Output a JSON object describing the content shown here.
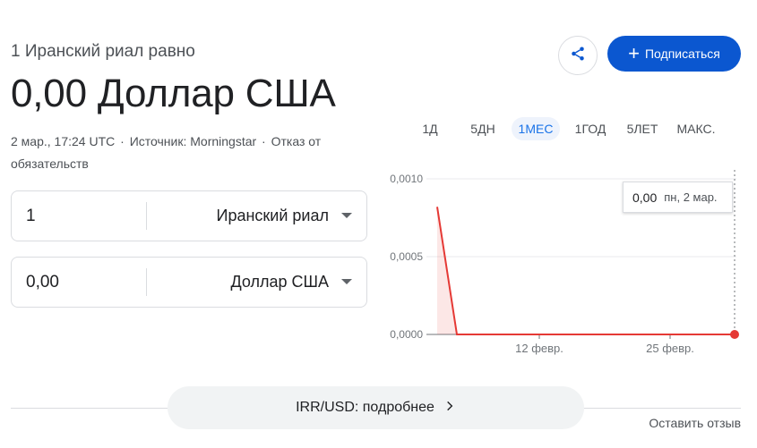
{
  "header": {
    "subtitle": "1 Иранский риал равно",
    "value": "0,00 Доллар США",
    "timestamp": "2 мар., 17:24 UTC",
    "source": "Источник: Morningstar",
    "disclaimer": "Отказ от обязательств",
    "share_icon": "share-icon",
    "subscribe_label": "Подписаться",
    "accent_color": "#0b57d0"
  },
  "converter": {
    "from": {
      "amount": "1",
      "currency": "Иранский риал"
    },
    "to": {
      "amount": "0,00",
      "currency": "Доллар США"
    }
  },
  "range_tabs": [
    {
      "label": "1Д",
      "active": false
    },
    {
      "label": "5ДН",
      "active": false
    },
    {
      "label": "1МЕС",
      "active": true
    },
    {
      "label": "1ГОД",
      "active": false
    },
    {
      "label": "5ЛЕТ",
      "active": false
    },
    {
      "label": "МАКС.",
      "active": false
    }
  ],
  "tooltip": {
    "value": "0,00",
    "date": "пн, 2 мар."
  },
  "chart_data": {
    "type": "line",
    "series": [
      {
        "x": [
          "30 янв.",
          "31 янв.",
          "12 февр.",
          "25 февр.",
          "2 мар."
        ],
        "values": [
          0.00082,
          0.0,
          0.0,
          0.0,
          0.0
        ]
      }
    ],
    "y_ticks": [
      "0,0010",
      "0,0005",
      "0,0000"
    ],
    "x_ticks": [
      "12 февр.",
      "25 февр."
    ],
    "ylim": [
      0,
      0.001
    ],
    "line_color": "#e53935",
    "grid": true
  },
  "footer": {
    "details_label": "IRR/USD: подробнее",
    "feedback_label": "Оставить отзыв"
  }
}
